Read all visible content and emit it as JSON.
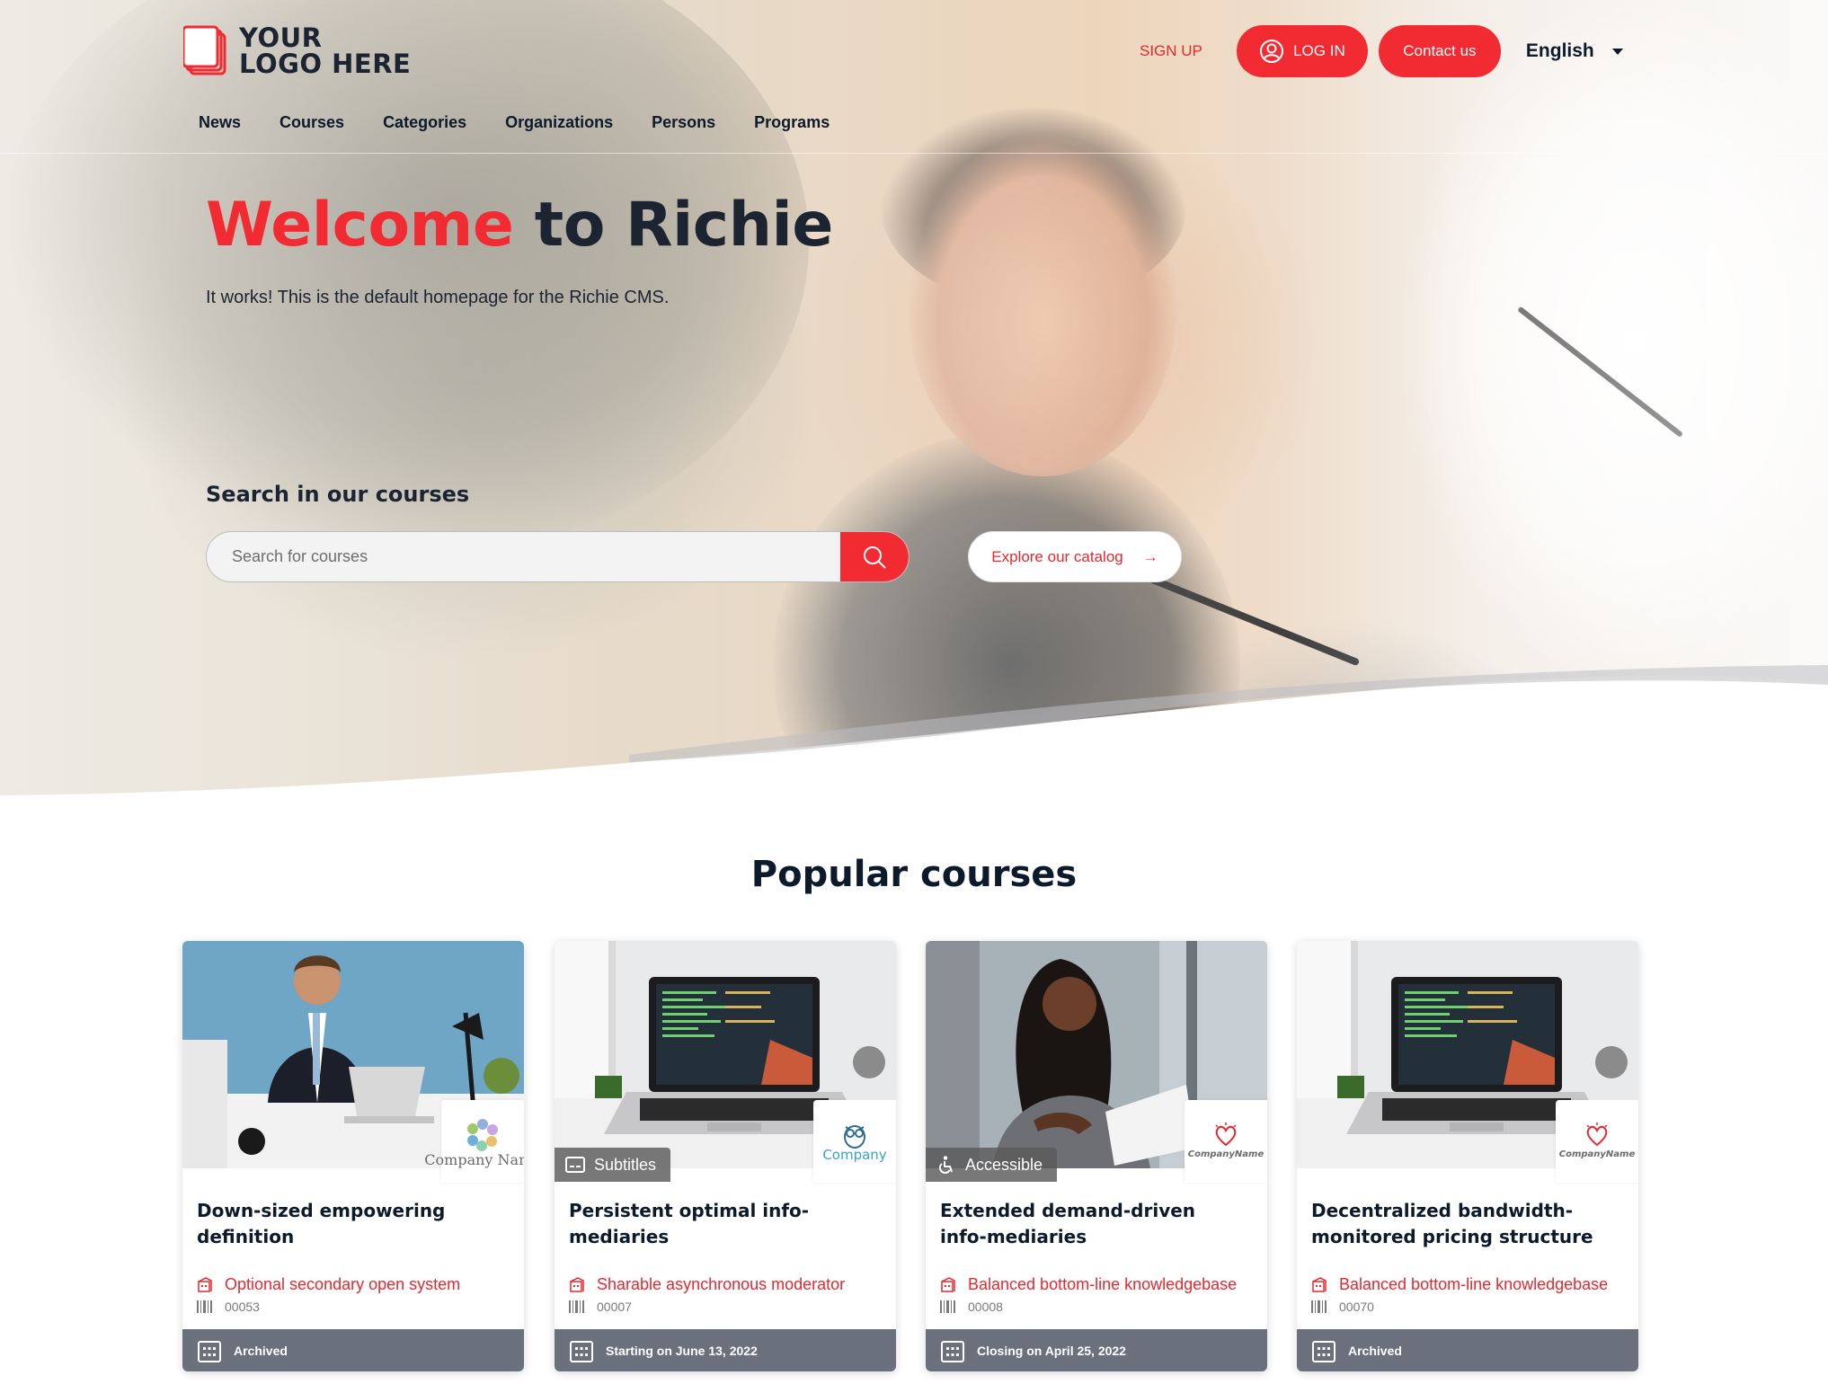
{
  "header": {
    "logo_line1": "YOUR",
    "logo_line2": "LOGO HERE",
    "signup_label": "SIGN UP",
    "login_label": "LOG IN",
    "contact_label": "Contact us",
    "language": "English",
    "nav": [
      "News",
      "Courses",
      "Categories",
      "Organizations",
      "Persons",
      "Programs"
    ]
  },
  "hero": {
    "title_accent": "Welcome",
    "title_rest": " to Richie",
    "subtitle": "It works! This is the default homepage for the Richie CMS.",
    "search_label": "Search in our courses",
    "search_placeholder": "Search for courses",
    "explore_label": "Explore our catalog",
    "explore_arrow": "→"
  },
  "popular": {
    "title": "Popular courses",
    "cards": [
      {
        "title": "Down-sized empowering definition",
        "organization": "Optional secondary open system",
        "code": "00053",
        "status": "Archived",
        "badge": "",
        "org_logo_text": "Company Name"
      },
      {
        "title": "Persistent optimal info-mediaries",
        "organization": "Sharable asynchronous moderator",
        "code": "00007",
        "status": "Starting on June 13, 2022",
        "badge": "Subtitles",
        "org_logo_text": "Company"
      },
      {
        "title": "Extended demand-driven info-mediaries",
        "organization": "Balanced bottom-line knowledgebase",
        "code": "00008",
        "status": "Closing on April 25, 2022",
        "badge": "Accessible",
        "org_logo_text": "CompanyName"
      },
      {
        "title": "Decentralized bandwidth-monitored pricing structure",
        "organization": "Balanced bottom-line knowledgebase",
        "code": "00070",
        "status": "Archived",
        "badge": "",
        "org_logo_text": "CompanyName"
      }
    ]
  },
  "colors": {
    "accent": "#f22a32",
    "text": "#0c1a2b",
    "card_footer": "#6b707d"
  }
}
